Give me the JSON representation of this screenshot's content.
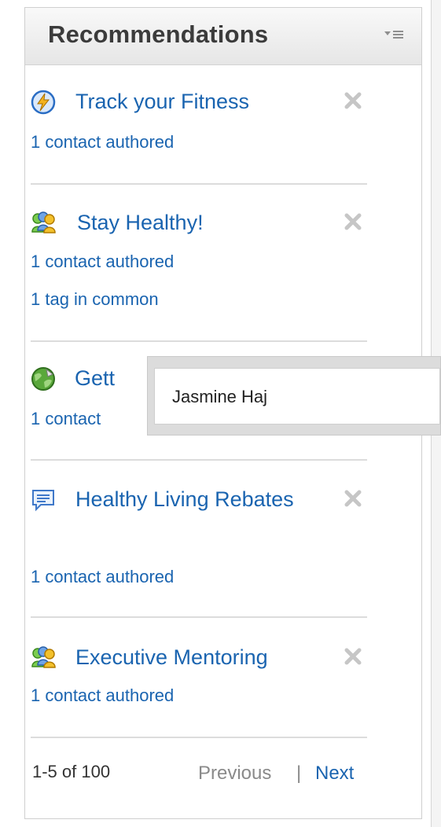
{
  "widget": {
    "title": "Recommendations",
    "menu_icon": "dropdown-menu-icon"
  },
  "items": [
    {
      "title": "Track your Fitness",
      "icon": "lightning-badge-icon",
      "meta": [
        "1 contact authored"
      ]
    },
    {
      "title": "Stay Healthy!",
      "icon": "community-people-icon",
      "meta": [
        "1 contact authored",
        "1 tag in common"
      ]
    },
    {
      "title": "Gett",
      "icon": "globe-arrow-icon",
      "meta": [
        "1 contact"
      ]
    },
    {
      "title": "Healthy Living Rebates",
      "icon": "forum-document-icon",
      "meta": [
        "1 contact authored"
      ]
    },
    {
      "title": "Executive Mentoring",
      "icon": "community-people-icon",
      "meta": [
        "1 contact authored"
      ]
    }
  ],
  "pager": {
    "count": "1-5 of 100",
    "previous": "Previous",
    "divider": "|",
    "next": "Next"
  },
  "tooltip": {
    "text": "Jasmine Haj"
  },
  "colors": {
    "link": "#1a64b0",
    "title": "#3b3b3b",
    "separator": "#dcdcdc"
  }
}
